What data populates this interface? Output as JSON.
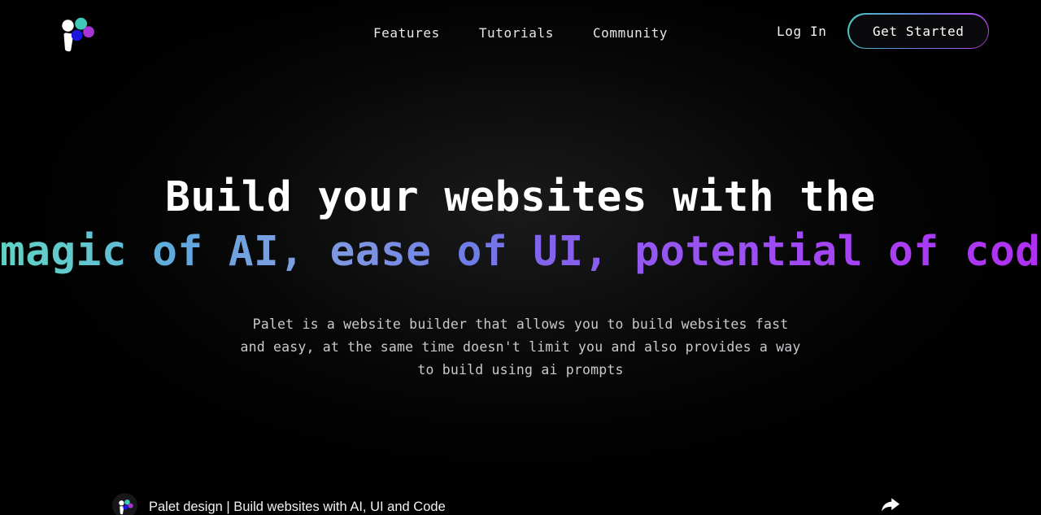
{
  "brand": {
    "name": "Palet",
    "logo_icon": "palet-logo-icon",
    "colors": {
      "dot_teal": "#3fc9b8",
      "dot_blue": "#1a15e0",
      "dot_purple": "#a833d6",
      "mark_white": "#ffffff"
    }
  },
  "header": {
    "nav": [
      {
        "label": "Features"
      },
      {
        "label": "Tutorials"
      },
      {
        "label": "Community"
      }
    ],
    "login_label": "Log In",
    "cta_label": "Get Started",
    "cta_gradient_start": "#4ec9c0",
    "cta_gradient_end": "#b14ad8"
  },
  "hero": {
    "headline_line1": "Build your websites with the",
    "headline_line2": "magic of AI, ease of UI, potential of code",
    "headline_gradient_start": "#5fd3c4",
    "headline_gradient_mid": "#7e96e2",
    "headline_gradient_end": "#b02ff2",
    "subtitle_lines": [
      "Palet is a website builder that allows you to build websites fast",
      "and easy, at the same time doesn't limit you and also provides a way",
      "to build using ai prompts"
    ]
  },
  "video": {
    "title": "Palet design | Build websites with AI, UI and Code",
    "avatar_icon": "palet-avatar-icon",
    "share_icon": "share-arrow-icon"
  }
}
